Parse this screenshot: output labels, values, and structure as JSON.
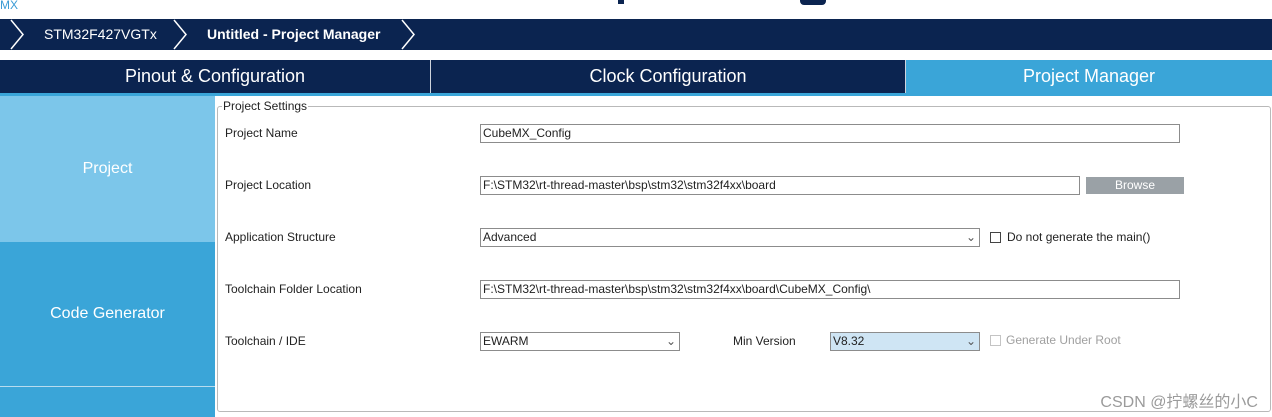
{
  "top_strip": {
    "logo_fragment": "MX"
  },
  "breadcrumb": {
    "items": [
      {
        "label": "STM32F427VGTx"
      },
      {
        "label": "Untitled - Project Manager"
      }
    ]
  },
  "tabs": [
    {
      "label": "Pinout & Configuration",
      "active": false
    },
    {
      "label": "Clock Configuration",
      "active": false
    },
    {
      "label": "Project Manager",
      "active": true
    }
  ],
  "sidebar": {
    "items": [
      {
        "label": "Project",
        "active": true
      },
      {
        "label": "Code Generator",
        "active": false
      }
    ]
  },
  "project_settings": {
    "legend": "Project Settings",
    "project_name": {
      "label": "Project Name",
      "value": "CubeMX_Config"
    },
    "project_location": {
      "label": "Project Location",
      "value": "F:\\STM32\\rt-thread-master\\bsp\\stm32\\stm32f4xx\\board",
      "browse_label": "Browse"
    },
    "application_structure": {
      "label": "Application Structure",
      "value": "Advanced",
      "checkbox_label": "Do not generate the main()",
      "checked": false
    },
    "toolchain_folder": {
      "label": "Toolchain Folder Location",
      "value": "F:\\STM32\\rt-thread-master\\bsp\\stm32\\stm32f4xx\\board\\CubeMX_Config\\"
    },
    "toolchain_ide": {
      "label": "Toolchain / IDE",
      "value": "EWARM",
      "min_version_label": "Min Version",
      "min_version_value": "V8.32",
      "gen_root_label": "Generate Under Root",
      "gen_root_checked": false
    }
  },
  "colors": {
    "navy": "#0b2450",
    "accent": "#3aa5d8",
    "sidebar_active": "#7cc6ea"
  },
  "watermark": "CSDN @拧螺丝的小C"
}
